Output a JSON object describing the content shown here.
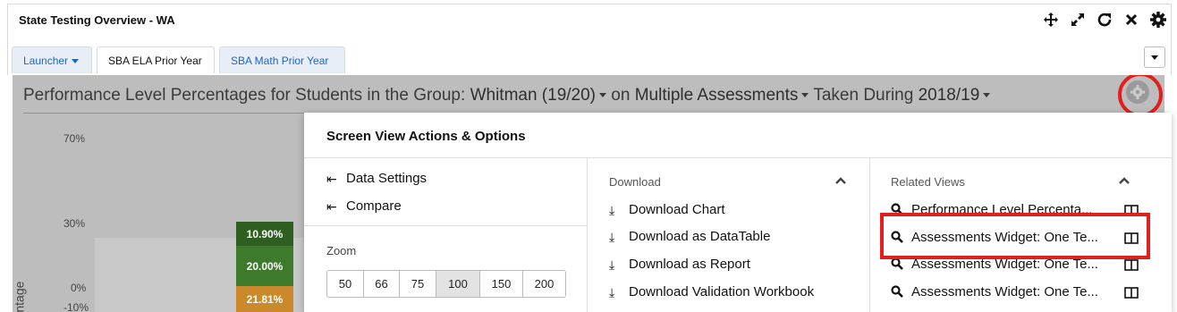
{
  "window": {
    "title": "State Testing Overview - WA"
  },
  "tabs": [
    {
      "label": "Launcher"
    },
    {
      "label": "SBA ELA Prior Year"
    },
    {
      "label": "SBA Math Prior Year"
    }
  ],
  "heading": {
    "prefix": "Performance Level Percentages for Students in the Group:",
    "group": "Whitman (19/20)",
    "on": "on",
    "assessments": "Multiple Assessments",
    "taken": "Taken During",
    "year": "2018/19"
  },
  "chart_data": {
    "type": "bar",
    "ylabel": "entage",
    "yticks": [
      "70%",
      "30%",
      "0%",
      "-10%"
    ],
    "segment_labels": [
      "10.90%",
      "20.00%",
      "21.81%"
    ],
    "values": [
      10.9,
      20.0,
      21.81
    ],
    "colors": [
      "#2e5f20",
      "#3d7a2c",
      "#ca8a2c"
    ]
  },
  "modal": {
    "title": "Screen View Actions & Options",
    "actions": [
      "Data Settings",
      "Compare"
    ],
    "zoom_label": "Zoom",
    "zoom_options": [
      "50",
      "66",
      "75",
      "100",
      "150",
      "200"
    ],
    "zoom_selected": "100",
    "download_heading": "Download",
    "downloads": [
      "Download Chart",
      "Download as DataTable",
      "Download as Report",
      "Download Validation Workbook"
    ],
    "related_heading": "Related Views",
    "related": [
      "Performance Level Percenta...",
      "Assessments Widget: One Te...",
      "Assessments Widget: One Te...",
      "Assessments Widget: One Te..."
    ]
  },
  "icons": {
    "title_tools": [
      "move-icon",
      "expand-icon",
      "refresh-icon",
      "close-icon",
      "gear-icon"
    ],
    "action_arrow": "⇤",
    "download_glyph": "⤓"
  },
  "colors": {
    "link_blue": "#1f66c1",
    "highlight_red": "#e21f1f"
  }
}
